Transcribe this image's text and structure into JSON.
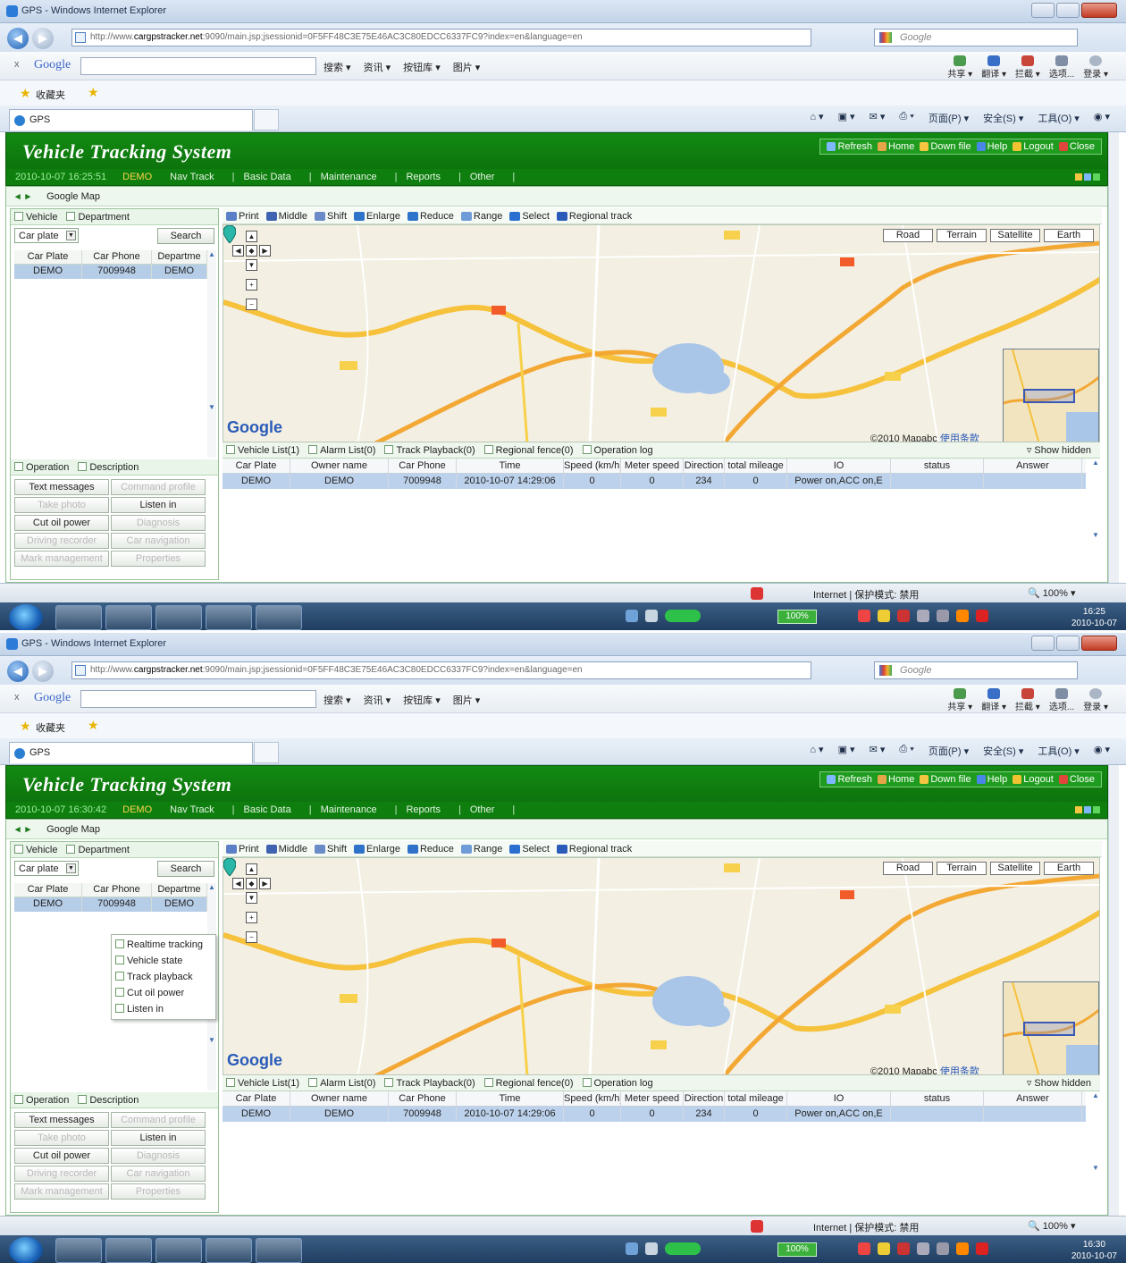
{
  "window_title": "GPS - Windows Internet Explorer",
  "address_url_prefix": "http://www.",
  "address_url_domain": "cargpstracker.net",
  "address_url_rest": ":9090/main.jsp;jsessionid=0F5FF48C3E75E46AC3C80EDCC6337FC9?index=en&language=en",
  "search_placeholder": "Google",
  "google_toolbar": {
    "brand": "Google",
    "tools": [
      "搜索 ▾",
      "资讯 ▾",
      "按钮库 ▾",
      "图片 ▾"
    ],
    "right": [
      "共享 ▾",
      "翻译 ▾",
      "拦截 ▾",
      "选项...",
      "登录 ▾"
    ]
  },
  "favorites_label": "收藏夹",
  "browser_tab": "GPS",
  "command_bar": [
    "页面(P) ▾",
    "安全(S) ▾",
    "工具(O) ▾",
    "◉ ▾"
  ],
  "app": {
    "brand": "Vehicle Tracking System",
    "header_buttons": [
      "Refresh",
      "Home",
      "Down file",
      "Help",
      "Logout",
      "Close"
    ],
    "user": "DEMO",
    "menu": [
      "Nav Track",
      "Basic Data",
      "Maintenance",
      "Reports",
      "Other"
    ],
    "crumb": "Google Map",
    "left_tabs": [
      "Vehicle",
      "Department"
    ],
    "select_value": "Car plate",
    "search_btn": "Search",
    "vehicle_cols": [
      "Car Plate",
      "Car Phone",
      "Departme"
    ],
    "vehicle_row": [
      "DEMO",
      "7009948",
      "DEMO"
    ],
    "vehicle_row_overlapped": "7009948",
    "op_tabs": [
      "Operation",
      "Description"
    ],
    "op_buttons": [
      {
        "label": "Text messages",
        "disabled": false
      },
      {
        "label": "Command profile",
        "disabled": true
      },
      {
        "label": "Take photo",
        "disabled": true
      },
      {
        "label": "Listen in",
        "disabled": false
      },
      {
        "label": "Cut oil power",
        "disabled": false
      },
      {
        "label": "Diagnosis",
        "disabled": true
      },
      {
        "label": "Driving recorder",
        "disabled": true
      },
      {
        "label": "Car navigation",
        "disabled": true
      },
      {
        "label": "Mark management",
        "disabled": true
      },
      {
        "label": "Properties",
        "disabled": true
      }
    ],
    "map_tools": [
      "Print",
      "Middle",
      "Shift",
      "Enlarge",
      "Reduce",
      "Range",
      "Select",
      "Regional track"
    ],
    "map_types": [
      "Road",
      "Terrain",
      "Satellite",
      "Earth"
    ],
    "map_logo": "Google",
    "map_copyright": "©2010 Mapabc",
    "map_copyright_link": "使用条款",
    "bottom_tabs": [
      "Vehicle List(1)",
      "Alarm List(0)",
      "Track Playback(0)",
      "Regional fence(0)",
      "Operation log"
    ],
    "show_hidden": "Show hidden",
    "grid_cols": [
      "Car Plate",
      "Owner name",
      "Car Phone",
      "Time",
      "Speed (km/h)",
      "Meter speed",
      "Direction",
      "total mileage",
      "IO",
      "status",
      "Answer"
    ],
    "grid_row": [
      "DEMO",
      "DEMO",
      "7009948",
      "2010-10-07 14:29:06",
      "0",
      "0",
      "234",
      "0",
      "Power on,ACC on,E",
      "",
      ""
    ],
    "context_menu": [
      "Realtime tracking",
      "Vehicle state",
      "Track playback",
      "Cut oil power",
      "Listen in"
    ]
  },
  "screens": [
    {
      "timestamp": "2010-10-07 16:25:51",
      "clock_time": "16:25",
      "clock_date": "2010-10-07"
    },
    {
      "timestamp": "2010-10-07 16:30:42",
      "clock_time": "16:30",
      "clock_date": "2010-10-07"
    }
  ],
  "status_zone": "Internet | 保护模式: 禁用",
  "status_zoom": "100%",
  "battery_pct": "100%"
}
